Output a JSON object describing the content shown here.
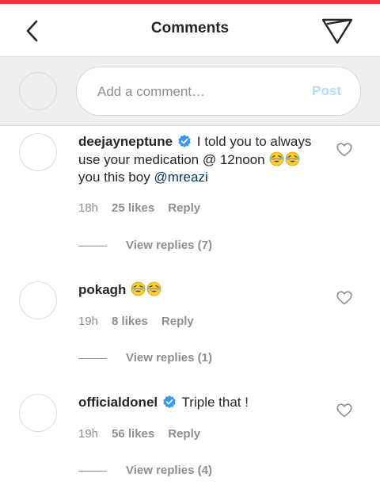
{
  "header": {
    "title": "Comments"
  },
  "composer": {
    "placeholder": "Add a comment…",
    "post_label": "Post"
  },
  "comments": [
    {
      "username": "deejayneptune",
      "verified": true,
      "text_part1": "I told you to always use your medication @ 12noon",
      "text_part2": "you this boy",
      "mention": "@mreazi",
      "emoji_count": 2,
      "time": "18h",
      "likes": "25 likes",
      "reply": "Reply",
      "view_replies": "View replies (7)"
    },
    {
      "username": "pokagh",
      "verified": false,
      "emoji_count": 2,
      "time": "19h",
      "likes": "8 likes",
      "reply": "Reply",
      "view_replies": "View replies (1)"
    },
    {
      "username": "officialdonel",
      "verified": true,
      "text": "Triple that !",
      "time": "19h",
      "likes": "56 likes",
      "reply": "Reply",
      "view_replies": "View replies (4)"
    }
  ],
  "colors": {
    "accent_strip": "#e53935",
    "verified_blue": "#3897f0",
    "post_disabled": "#b3dbff",
    "meta_gray": "#8e8e8e",
    "mention_blue": "#003569"
  },
  "icons": [
    "back-arrow-icon",
    "direct-send-icon",
    "verified-badge-icon",
    "laughing-emoji-icon",
    "heart-outline-icon"
  ]
}
